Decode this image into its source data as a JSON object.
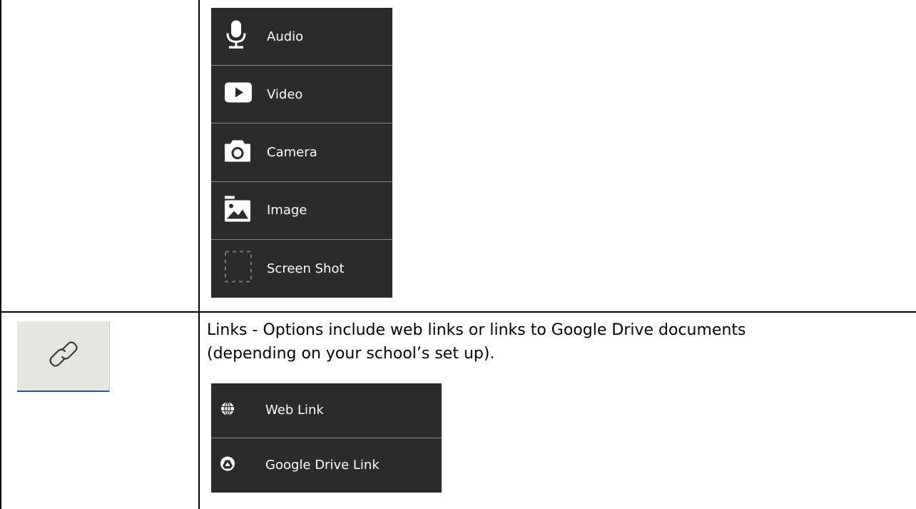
{
  "media_menu": {
    "items": [
      {
        "label": "Audio",
        "icon": "microphone-icon"
      },
      {
        "label": "Video",
        "icon": "play-icon"
      },
      {
        "label": "Camera",
        "icon": "camera-icon"
      },
      {
        "label": "Image",
        "icon": "image-icon"
      },
      {
        "label": "Screen Shot",
        "icon": "screenshot-icon"
      }
    ]
  },
  "links_row": {
    "icon": "link-icon",
    "description_line1": "Links - Options include web links or links to Google Drive documents",
    "description_line2": "(depending on your school’s set up)."
  },
  "link_menu": {
    "items": [
      {
        "label": "Web Link",
        "icon": "globe-icon"
      },
      {
        "label": "Google Drive Link",
        "icon": "google-drive-icon"
      }
    ]
  },
  "colors": {
    "menu_background": "#2b2b2b",
    "menu_text": "#ffffff",
    "link_box_background": "#e6e6e0"
  }
}
